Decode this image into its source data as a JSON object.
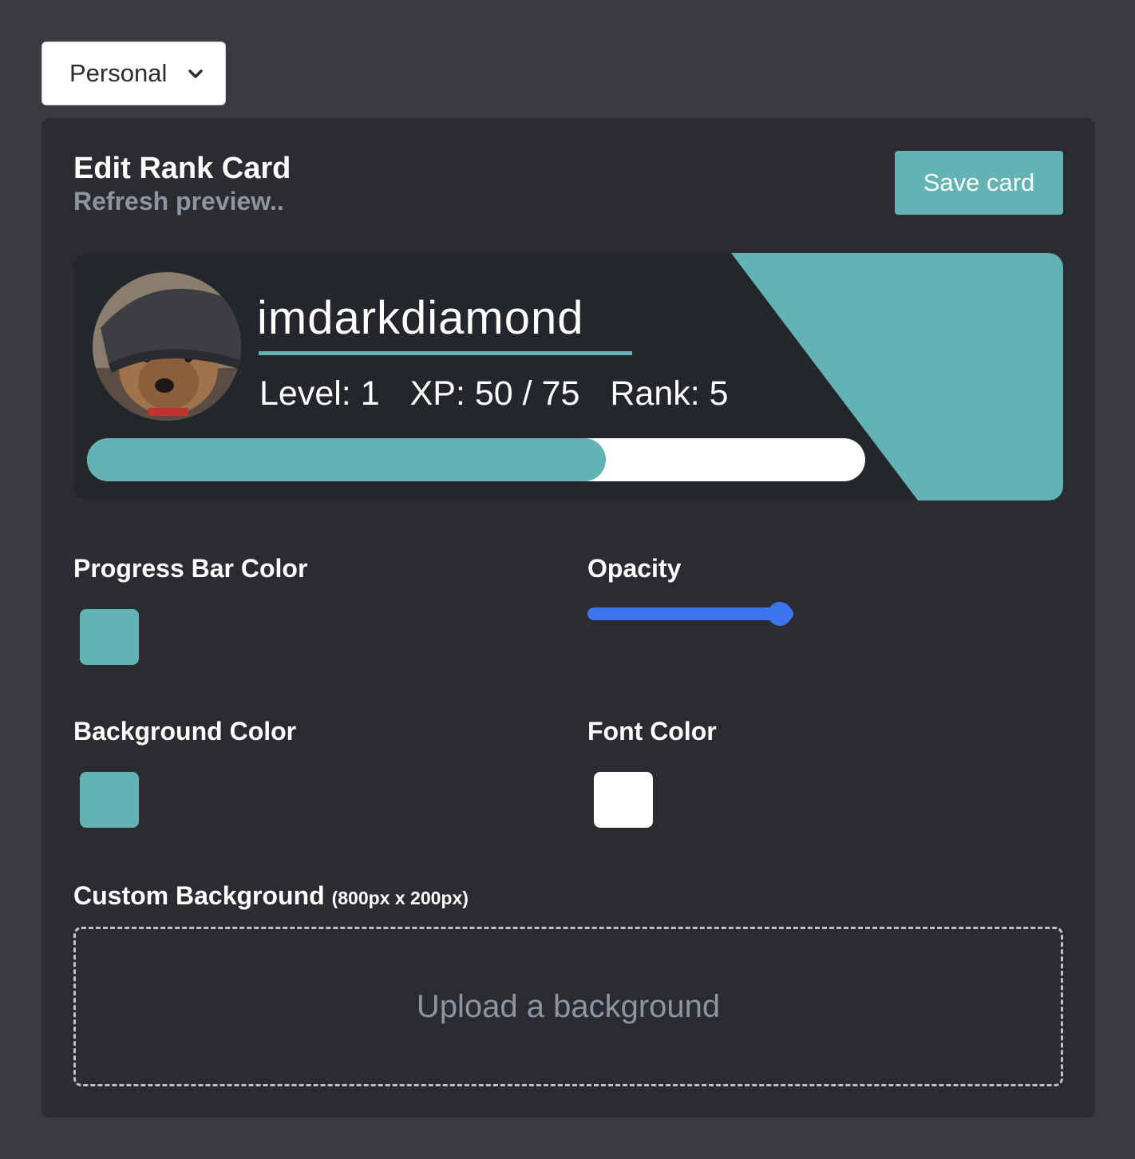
{
  "server_select": {
    "value": "Personal"
  },
  "editor": {
    "title": "Edit Rank Card",
    "subtitle": "Refresh preview..",
    "save_label": "Save card"
  },
  "card": {
    "username": "imdarkdiamond",
    "level_text": "Level: 1",
    "xp_text": "XP: 50 / 75",
    "rank_text": "Rank: 5",
    "xp_current": 50,
    "xp_max": 75
  },
  "settings": {
    "progress_bar_color_label": "Progress Bar Color",
    "progress_bar_color": "#63b3b4",
    "opacity_label": "Opacity",
    "opacity_value": 1.0,
    "background_color_label": "Background Color",
    "background_color": "#63b3b4",
    "font_color_label": "Font Color",
    "font_color": "#ffffff",
    "custom_background_label": "Custom Background",
    "custom_background_hint": "(800px x 200px)",
    "upload_label": "Upload a background"
  },
  "colors": {
    "accent": "#63b3b4",
    "slider": "#3b74ee",
    "panel": "#2b2c31",
    "page": "#3a3b40"
  }
}
